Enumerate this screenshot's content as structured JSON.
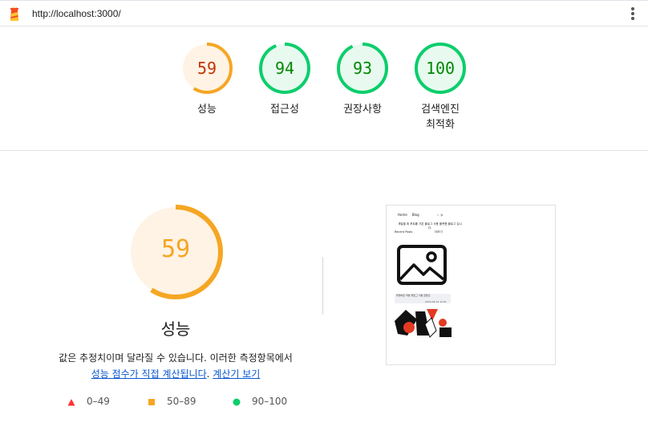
{
  "header": {
    "url": "http://localhost:3000/",
    "logo_icon": "lighthouse-icon",
    "menu_icon": "kebab-menu-icon"
  },
  "colors": {
    "average": "#f5a623",
    "average_text": "#c33300",
    "pass": "#0cce6b",
    "pass_text": "#008800",
    "pass_bg": "#e8faf0",
    "average_bg": "#fff3e5",
    "fail": "#ff3333",
    "link": "#0b57d0"
  },
  "gauges": [
    {
      "score": 59,
      "label": "성능",
      "status": "average"
    },
    {
      "score": 94,
      "label": "접근성",
      "status": "pass"
    },
    {
      "score": 93,
      "label": "권장사항",
      "status": "pass"
    },
    {
      "score": 100,
      "label": "검색엔진\n최적화",
      "status": "pass"
    }
  ],
  "main": {
    "score": 59,
    "title": "성능",
    "desc_line1": "값은 추정치이며 달라질 수 있습니다. 이러한 측정항목에서",
    "link1": "성능 점수가 직접 계산됩니다",
    "sep": ". ",
    "link2": "계산기 보기"
  },
  "legend": [
    {
      "range": "0–49",
      "shape": "triangle",
      "status": "fail"
    },
    {
      "range": "50–89",
      "shape": "square",
      "status": "average"
    },
    {
      "range": "90–100",
      "shape": "circle",
      "status": "pass"
    }
  ],
  "thumbnail": {
    "nav": [
      "Home",
      "Blog"
    ],
    "heading": "개발을 위 포트폴 기본 블로그 사용 플랫폼 블로그 입니다.",
    "recent_label": "Recent Posts",
    "more_label": "더보기",
    "card_title": "무엇이든 작성 블로그 기본 콘텐츠",
    "card_date": "2024.09.12 12:01"
  }
}
